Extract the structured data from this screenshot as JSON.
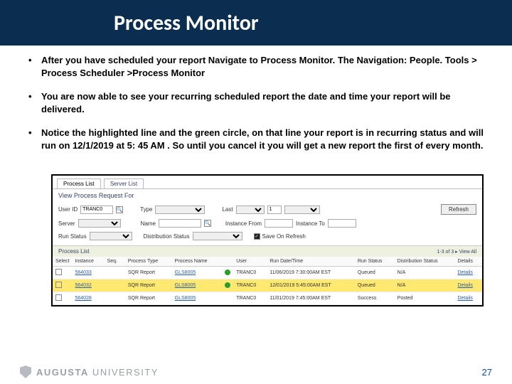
{
  "header": {
    "title": "Process Monitor"
  },
  "bullets": [
    "After you have scheduled your report  Navigate to  Process Monitor. The Navigation: People. Tools > Process Scheduler >Process Monitor",
    "You are now able to see your recurring scheduled report  the date and time your report will be delivered.",
    "Notice the highlighted line  and  the green circle, on that line your report  is in recurring status and will run on 12/1/2019 at 5: 45 AM . So until you cancel it you will get a new report the first of every month."
  ],
  "pm": {
    "tabs": {
      "active": "Process List",
      "other": "Server List"
    },
    "section_view": "View Process Request For",
    "filters": {
      "userid_label": "User ID",
      "userid_value": "TRANC0",
      "type_label": "Type",
      "last_label": "Last",
      "last_value": "1",
      "refresh_label": "Refresh",
      "server_label": "Server",
      "name_label": "Name",
      "instance_label": "Instance From",
      "instance_to_label": "Instance To",
      "runstatus_label": "Run Status",
      "diststatus_label": "Distribution Status",
      "save_label": "Save On Refresh"
    },
    "list_label": "Process List",
    "nav_label": "1-3 of 3  ▸  View All",
    "columns": [
      "Select",
      "Instance",
      "Seq.",
      "Process Type",
      "Process Name",
      "",
      "User",
      "Run Date/Time",
      "Run Status",
      "Distribution Status",
      "Details"
    ],
    "rows": [
      {
        "instance": "564033",
        "seq": "",
        "ptype": "SQR Report",
        "pname": "GLS8005",
        "green": true,
        "user": "TRANC0",
        "rundate": "11/06/2019 7:30:00AM EST",
        "runstatus": "Queued",
        "diststatus": "N/A",
        "details": "Details",
        "highlight": false
      },
      {
        "instance": "564032",
        "seq": "",
        "ptype": "SQR Report",
        "pname": "GLS8005",
        "green": true,
        "user": "TRANC0",
        "rundate": "12/01/2019 5:45:00AM EST",
        "runstatus": "Queued",
        "diststatus": "N/A",
        "details": "Details",
        "highlight": true
      },
      {
        "instance": "564028",
        "seq": "",
        "ptype": "SQR Report",
        "pname": "GLS8005",
        "green": false,
        "user": "TRANC0",
        "rundate": "11/01/2019 7:45:00AM EST",
        "runstatus": "Success",
        "diststatus": "Posted",
        "details": "Details",
        "highlight": false
      }
    ]
  },
  "footer": {
    "logo_main": "AUGUSTA",
    "logo_sub": " UNIVERSITY",
    "page": "27"
  }
}
